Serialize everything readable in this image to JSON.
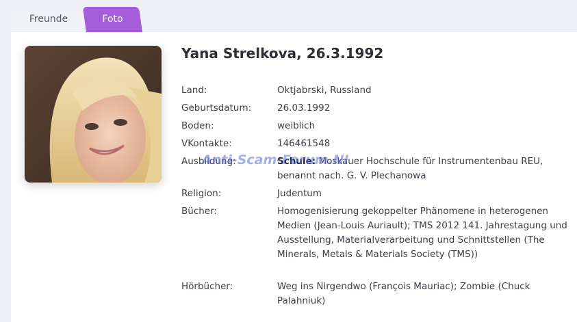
{
  "tabs": [
    {
      "label": "Freunde",
      "active": false
    },
    {
      "label": "Foto",
      "active": true
    }
  ],
  "colors": {
    "accent": "#a55ddb",
    "background": "#eef0f6",
    "card": "#ffffff"
  },
  "profile": {
    "title": "Yana Strelkova, 26.3.1992",
    "photo_icon": "profile-photo",
    "fields": [
      {
        "label": "Land:",
        "value": "Oktjabrski, Russland"
      },
      {
        "label": "Geburtsdatum:",
        "value": "26.03.1992"
      },
      {
        "label": "Boden:",
        "value": "weiblich"
      },
      {
        "label": "VKontakte:",
        "value": "146461548"
      },
      {
        "label": "Ausbildung:",
        "value_prefix": "Schule:",
        "value": "Moskauer Hochschule für Instrumentenbau REU, benannt nach. G. V. Plechanowa"
      },
      {
        "label": "Religion:",
        "value": "Judentum"
      },
      {
        "label": "Bücher:",
        "value": "Homogenisierung gekoppelter Phänomene in heterogenen Medien (Jean-Louis Auriault); TMS 2012 141. Jahrestagung und Ausstellung, Materialverarbeitung und Schnittstellen (The Minerals, Metals & Materials Society (TMS))"
      },
      {
        "label": "Hörbücher:",
        "value": "Weg ins Nirgendwo (François Mauriac); Zombie (Chuck Palahniuk)"
      }
    ]
  },
  "watermark": "Anti-Scam-Forum.NI"
}
